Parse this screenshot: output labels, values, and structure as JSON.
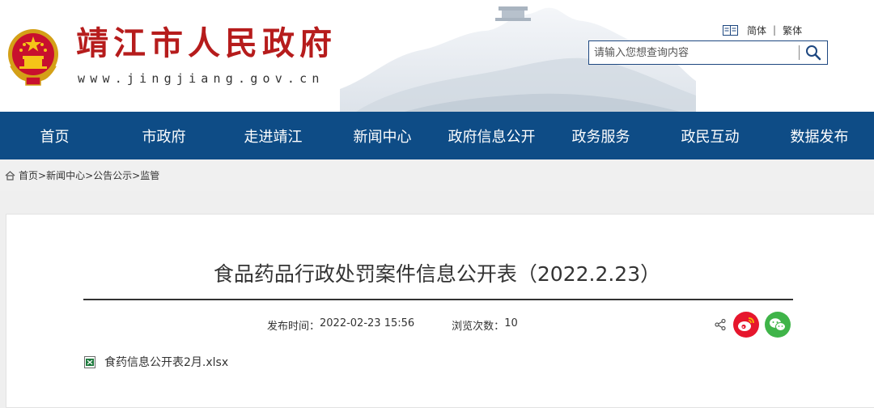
{
  "header": {
    "site_name": "靖江市人民政府",
    "site_url": "www.jingjiang.gov.cn",
    "lang_simplified": "简体",
    "lang_separator": "|",
    "lang_traditional": "繁体",
    "search_placeholder": "请输入您想查询内容"
  },
  "nav": {
    "items": [
      "首页",
      "市政府",
      "走进靖江",
      "新闻中心",
      "政府信息公开",
      "政务服务",
      "政民互动",
      "数据发布"
    ]
  },
  "breadcrumb": {
    "items": [
      "首页",
      "新闻中心",
      "公告公示",
      "监管"
    ],
    "separator": ">"
  },
  "article": {
    "title": "食品药品行政处罚案件信息公开表（2022.2.23）",
    "publish_label": "发布时间：",
    "publish_time": "2022-02-23 15:56",
    "views_label": "浏览次数：",
    "views": "10",
    "attachment": "食药信息公开表2月.xlsx"
  },
  "colors": {
    "brand_red": "#b61c1c",
    "nav_blue": "#0e4c86",
    "weibo_red": "#e6162d",
    "wechat_green": "#3fb449"
  },
  "icons": [
    "national-emblem-icon",
    "book-icon",
    "search-icon",
    "home-icon",
    "share-icon",
    "weibo-icon",
    "wechat-icon",
    "excel-file-icon"
  ]
}
